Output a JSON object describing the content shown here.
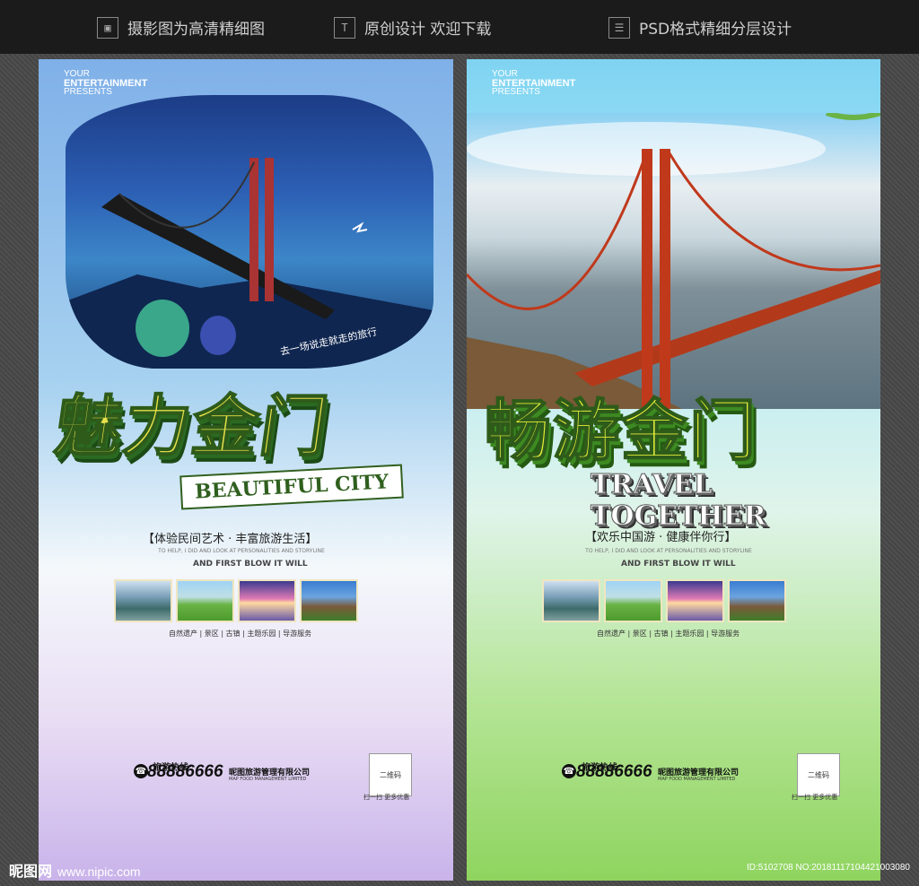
{
  "top_features": [
    {
      "icon": "image-layers-icon",
      "label": "摄影图为高清精细图"
    },
    {
      "icon": "text-T-icon",
      "label": "原创设计 欢迎下载"
    },
    {
      "icon": "layers-icon",
      "label": "PSD格式精细分层设计"
    }
  ],
  "posters": [
    {
      "present_line1": "YOUR",
      "present_line2": "ENTERTAINMENT",
      "present_line3": "PRESENTS",
      "title": "魅力金门",
      "ribbon": "BEAUTIFUL CITY",
      "slogan": "【体验民间艺术 · 丰富旅游生活】",
      "fine_text": "TO HELP, I DID AND LOOK AT PERSONALITIES AND STORYLINE",
      "fine_bold": "AND FIRST BLOW IT WILL",
      "tags": "自然遗产 | 景区 | 古镇 | 主题乐园 | 导游服务",
      "hotline_label": "旅游热线:",
      "phone": "88886666",
      "company": "昵图旅游管理有限公司",
      "company_en": "MAP FOOD MANAGEMENT LIMITED",
      "qr_label": "二维码",
      "qr_caption": "扫一扫  更多优惠",
      "photo_text": "去一场说走就走的旅行"
    },
    {
      "present_line1": "YOUR",
      "present_line2": "ENTERTAINMENT",
      "present_line3": "PRESENTS",
      "title": "畅游金门",
      "ribbon": "TRAVEL TOGETHER",
      "slogan": "【欢乐中国游 · 健康伴你行】",
      "fine_text": "TO HELP, I DID AND LOOK AT PERSONALITIES AND STORYLINE",
      "fine_bold": "AND FIRST BLOW IT WILL",
      "tags": "自然遗产 | 景区 | 古镇 | 主题乐园 | 导游服务",
      "hotline_label": "旅游热线:",
      "phone": "88886666",
      "company": "昵图旅游管理有限公司",
      "company_en": "MAP FOOD MANAGEMENT LIMITED",
      "qr_label": "二维码",
      "qr_caption": "扫一扫  更多优惠"
    }
  ],
  "footer": {
    "brand": "昵图网",
    "site": "www.nipic.com",
    "id_text": "ID:5102708 NO:20181117104421003080"
  }
}
